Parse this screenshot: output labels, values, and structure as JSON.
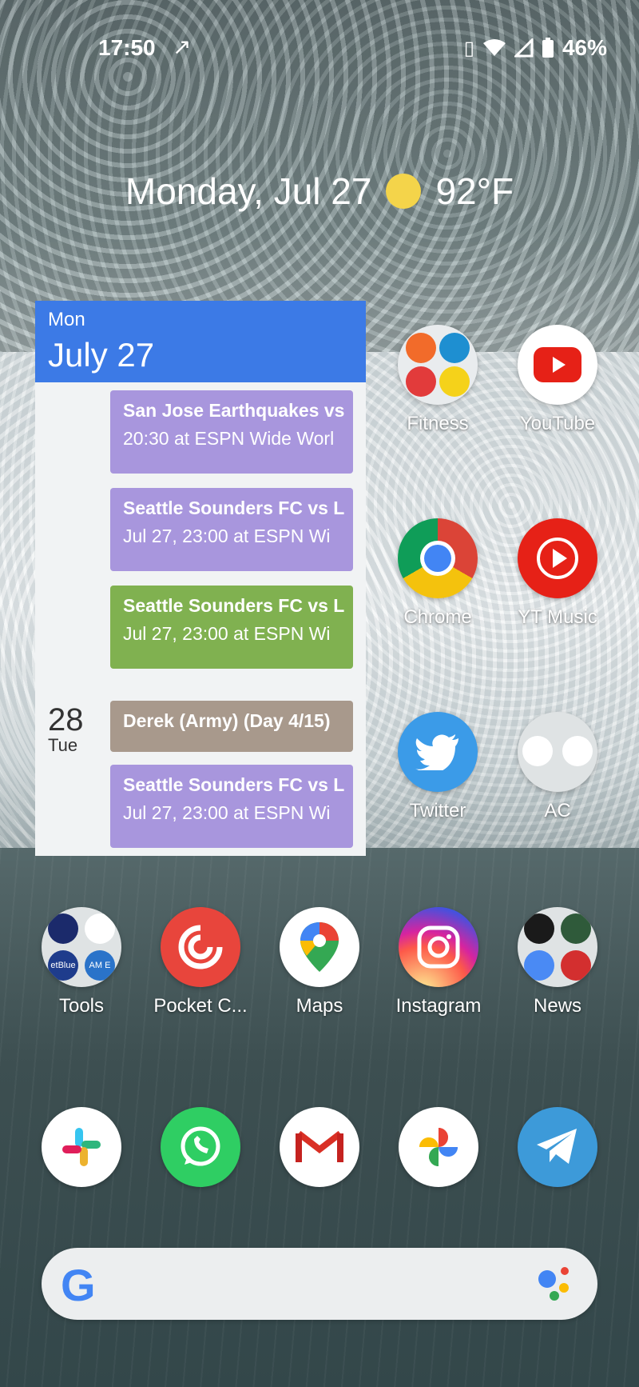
{
  "status_bar": {
    "time": "17:50",
    "battery_text": "46%"
  },
  "glance": {
    "date": "Monday, Jul 27",
    "temperature": "92°F",
    "weather_icon": "sun-icon"
  },
  "calendar": {
    "header_dow": "Mon",
    "header_day": "July 27",
    "events": [
      {
        "title": "San Jose Earthquakes vs",
        "detail": "20:30 at ESPN Wide Worl"
      },
      {
        "title": "Seattle Sounders FC vs L",
        "detail": "Jul 27, 23:00 at ESPN Wi"
      },
      {
        "title": "Seattle Sounders FC vs L",
        "detail": "Jul 27, 23:00 at ESPN Wi"
      },
      {
        "title": "Derek (Army) (Day 4/15)"
      },
      {
        "title": "Seattle Sounders FC vs L",
        "detail": "Jul 27, 23:00 at ESPN Wi"
      }
    ],
    "next_day_num": "28",
    "next_day_dow": "Tue",
    "colors": {
      "header": "#3c7ae6",
      "purple": "#a896dd",
      "green": "#80b150",
      "tan": "#a8998c"
    }
  },
  "apps": {
    "fitness": "Fitness",
    "youtube": "YouTube",
    "chrome": "Chrome",
    "yt_music": "YT Music",
    "twitter": "Twitter",
    "ac": "AC",
    "tools": "Tools",
    "pocket_casts": "Pocket C...",
    "maps": "Maps",
    "instagram": "Instagram",
    "news": "News"
  },
  "folder_texts": {
    "jetblue": "etBlue",
    "amex": "AM E"
  },
  "dock_icons": [
    "slack-icon",
    "whatsapp-icon",
    "gmail-icon",
    "photos-icon",
    "telegram-icon"
  ],
  "search": {
    "logo": "G"
  }
}
